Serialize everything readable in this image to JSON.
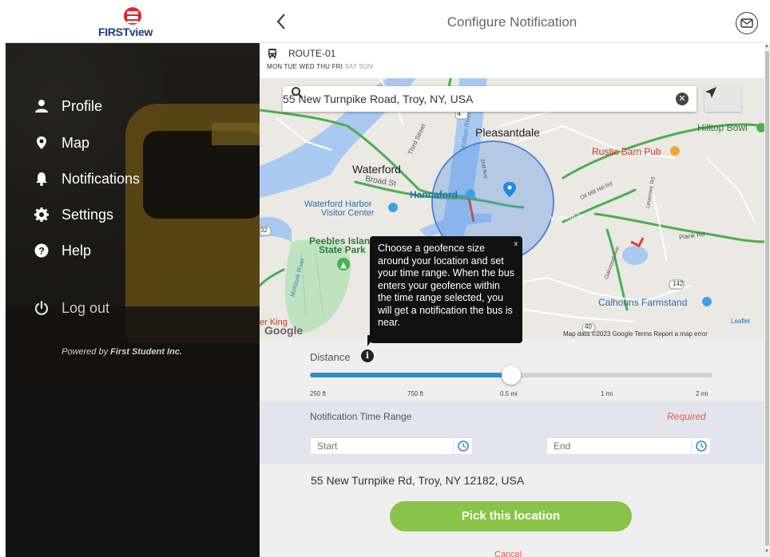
{
  "brand": {
    "logo_text": "FIRSTview",
    "brand_color": "#e2232a"
  },
  "sidebar": {
    "items": [
      {
        "label": "Profile",
        "icon": "user-icon"
      },
      {
        "label": "Map",
        "icon": "map-pin-icon"
      },
      {
        "label": "Notifications",
        "icon": "bell-icon"
      },
      {
        "label": "Settings",
        "icon": "gear-icon"
      },
      {
        "label": "Help",
        "icon": "help-icon"
      }
    ],
    "logout_label": "Log out",
    "powered_prefix": "Powered by ",
    "powered_company": "First Student Inc."
  },
  "header": {
    "title": "Configure Notification",
    "back_icon": "chevron-left-icon",
    "mail_icon": "mail-icon"
  },
  "route": {
    "name": "ROUTE-01",
    "days_active": "MON TUE WED THU FRI",
    "days_inactive": "SAT SUN"
  },
  "map": {
    "search_value": "55 New Turnpike Road, Troy, NY, USA",
    "labels": {
      "pleasantdale": "Pleasantdale",
      "waterford": "Waterford",
      "broad_st": "Broad St",
      "hannaford": "Hannaford",
      "waterford_harbor": "Waterford Harbor",
      "visitor_center": "Visitor Center",
      "peebles": "Peebles Islan",
      "state_park": "State Park",
      "hilltop": "Hilltop Bowl",
      "rustic": "Rustic Barn Pub",
      "calhouns": "Calhouns Farmstand",
      "northern_dr": "Northern Dr",
      "plank_rd": "Plank Rd",
      "hudson_river": "Hudson River",
      "third_street": "Third Street",
      "mohawk_river": "Mohawk River",
      "second_ave": "2nd Ave",
      "oil_mill_hill_rd": "Oil Mill Hill Rd",
      "oakwood_ave": "Oakwood Ave",
      "leversee_rd": "Leversee Rd",
      "route_4": "4",
      "route_142": "142",
      "route_40": "40",
      "route_32": "32",
      "burger_king": "er King",
      "google": "Google"
    },
    "attribution": "Map data ©2023 Google   Terms   Report a map error",
    "leaflet": "Leaflet"
  },
  "tooltip": {
    "text": "Choose a geofence size around your location and set your time range. When the bus enters your geofence within the time range selected, you will get a notification the bus is near.",
    "close": "x"
  },
  "distance": {
    "label": "Distance",
    "ticks": [
      "250 ft",
      "750 ft",
      "0.5 mi",
      "1 mi",
      "2 mi"
    ],
    "selected_value": "0.5 mi",
    "slider_fraction": 0.5,
    "accent": "#2f8fc4"
  },
  "time_range": {
    "label": "Notification Time Range",
    "required": "Required",
    "start_placeholder": "Start",
    "end_placeholder": "End",
    "accent": "#2f8fc4"
  },
  "address": "55 New Turnpike Rd, Troy, NY 12182, USA",
  "pick_button": {
    "label": "Pick this location",
    "color": "#8bc34a"
  },
  "cancel_label": "Cancel"
}
